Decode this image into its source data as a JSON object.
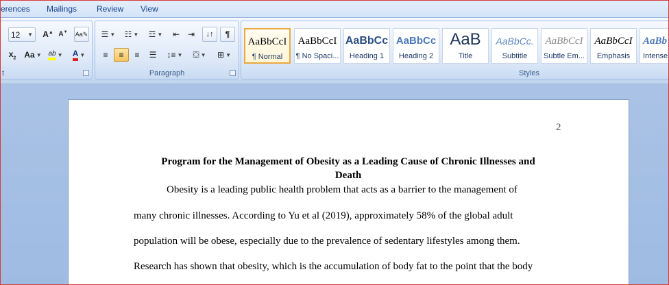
{
  "tabs": [
    "erences",
    "Mailings",
    "Review",
    "View"
  ],
  "font": {
    "size": "12"
  },
  "groups": {
    "font_label": "t",
    "paragraph_label": "Paragraph",
    "styles_label": "Styles"
  },
  "styles": [
    {
      "sample": "AaBbCcI",
      "name": "¶ Normal"
    },
    {
      "sample": "AaBbCcI",
      "name": "¶ No Spaci..."
    },
    {
      "sample": "AaBbCc",
      "name": "Heading 1"
    },
    {
      "sample": "AaBbCc",
      "name": "Heading 2"
    },
    {
      "sample": "AaB",
      "name": "Title"
    },
    {
      "sample": "AaBbCc.",
      "name": "Subtitle"
    },
    {
      "sample": "AaBbCcI",
      "name": "Subtle Em..."
    },
    {
      "sample": "AaBbCcI",
      "name": "Emphasis"
    },
    {
      "sample": "AaBb",
      "name": "Intense"
    }
  ],
  "document": {
    "page_number": "2",
    "title_line1": "Program for the Management of Obesity as a Leading Cause of Chronic Illnesses and",
    "title_line2": "Death",
    "lines": [
      "Obesity is a leading public health problem that acts as a barrier to the management of",
      "many chronic illnesses.  According to Yu et al (2019), approximately  58% of the global adult",
      "population will be obese, especially  due to the prevalence of sedentary lifestyles among them.",
      "Research has shown that obesity, which is  the accumulation  of body fat to the point that the body"
    ]
  },
  "colors": {
    "highlight": "#ffff00",
    "font_color": "#e02020",
    "selected_style": "#e9a93f"
  }
}
